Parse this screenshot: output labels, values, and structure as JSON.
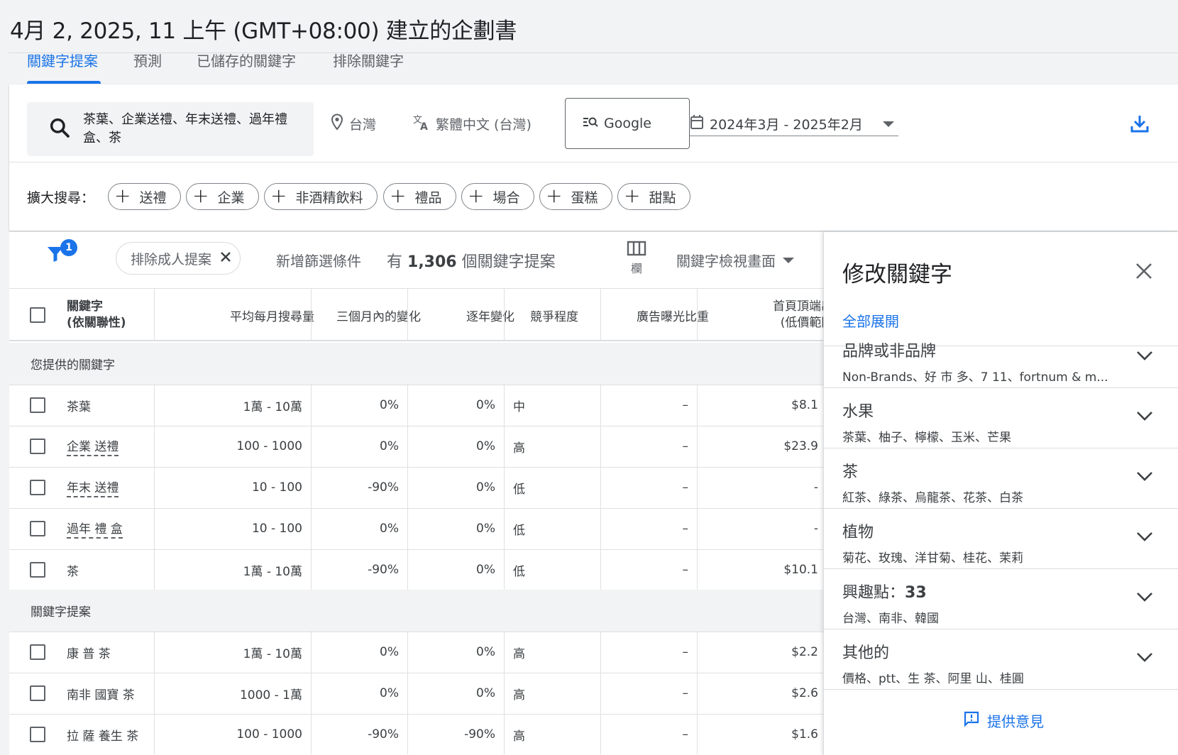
{
  "page": {
    "title": "4月 2, 2025, 11 上午 (GMT+08:00) 建立的企劃書"
  },
  "tabs": [
    {
      "label": "關鍵字提案",
      "active": true
    },
    {
      "label": "預測"
    },
    {
      "label": "已儲存的關鍵字"
    },
    {
      "label": "排除關鍵字"
    }
  ],
  "search": {
    "value": "茶葉、企業送禮、年末送禮、過年禮盒、茶",
    "icon": "search-icon"
  },
  "location": {
    "label": "台灣",
    "icon": "location-pin-icon"
  },
  "language": {
    "label": "繁體中文 (台灣)",
    "icon": "translate-icon"
  },
  "network": {
    "label": "Google",
    "icon": "search-network-icon"
  },
  "date_range": {
    "label": "2024年3月 - 2025年2月",
    "icon": "calendar-icon"
  },
  "download": {
    "icon": "download-icon"
  },
  "expand_search": {
    "label": "擴大搜尋：",
    "chips": [
      "送禮",
      "企業",
      "非酒精飲料",
      "禮品",
      "場合",
      "蛋糕",
      "甜點"
    ]
  },
  "filter_bar": {
    "filter_badge": "1",
    "chip_label": "排除成人提案",
    "add_filter": "新增篩選條件",
    "count_prefix": "有",
    "count": "1,306",
    "count_suffix": "個關鍵字提案",
    "columns_label": "欄",
    "view_label": "關鍵字檢視畫面"
  },
  "table": {
    "headers": {
      "keyword_1": "關鍵字",
      "keyword_2": "(依關聯性)",
      "avg_searches": "平均每月搜尋量",
      "three_month": "三個月內的變化",
      "yoy": "逐年變化",
      "competition": "競爭程度",
      "impression_share": "廣告曝光比重",
      "top_bid_1": "首頁頂端出價",
      "top_bid_2": "(低價範圍)"
    },
    "group1": "您提供的關鍵字",
    "rows1": [
      {
        "kw": "茶葉",
        "avg": "1萬 - 10萬",
        "m3": "0%",
        "yoy": "0%",
        "comp": "中",
        "share": "–",
        "bid": "$8.1",
        "dotted": false
      },
      {
        "kw": "企業 送禮",
        "avg": "100 - 1000",
        "m3": "0%",
        "yoy": "0%",
        "comp": "高",
        "share": "–",
        "bid": "$23.9",
        "dotted": true
      },
      {
        "kw": "年末 送禮",
        "avg": "10 - 100",
        "m3": "-90%",
        "yoy": "0%",
        "comp": "低",
        "share": "–",
        "bid": "-",
        "dotted": true
      },
      {
        "kw": "過年 禮 盒",
        "avg": "10 - 100",
        "m3": "0%",
        "yoy": "0%",
        "comp": "低",
        "share": "–",
        "bid": "-",
        "dotted": true
      },
      {
        "kw": "茶",
        "avg": "1萬 - 10萬",
        "m3": "-90%",
        "yoy": "0%",
        "comp": "低",
        "share": "–",
        "bid": "$10.1",
        "dotted": false
      }
    ],
    "group2": "關鍵字提案",
    "rows2": [
      {
        "kw": "康 普 茶",
        "avg": "1萬 - 10萬",
        "m3": "0%",
        "yoy": "0%",
        "comp": "高",
        "share": "–",
        "bid": "$2.2",
        "dotted": false
      },
      {
        "kw": "南非 國寶 茶",
        "avg": "1000 - 1萬",
        "m3": "0%",
        "yoy": "0%",
        "comp": "高",
        "share": "–",
        "bid": "$2.6",
        "dotted": false
      },
      {
        "kw": "拉 薩 養生 茶",
        "avg": "100 - 1000",
        "m3": "-90%",
        "yoy": "-90%",
        "comp": "高",
        "share": "–",
        "bid": "$1.6",
        "dotted": false
      }
    ]
  },
  "panel": {
    "title": "修改關鍵字",
    "expand_all": "全部展開",
    "groups": [
      {
        "title": "品牌或非品牌",
        "sub": "Non-Brands、好 市 多、7 11、fortnum & m..."
      },
      {
        "title": "水果",
        "sub": "茶葉、柚子、檸檬、玉米、芒果"
      },
      {
        "title": "茶",
        "sub": "紅茶、綠茶、烏龍茶、花茶、白茶"
      },
      {
        "title": "植物",
        "sub": "菊花、玫瑰、洋甘菊、桂花、茉莉"
      },
      {
        "title": "興趣點：",
        "title_count": "33",
        "sub": "台灣、南非、韓國"
      },
      {
        "title": "其他的",
        "sub": "價格、ptt、生 茶、阿里 山、桂圓"
      }
    ],
    "feedback": "提供意見"
  },
  "colors": {
    "accent": "#1a73e8",
    "text": "#3c4043",
    "bg": "#f1f3f4"
  }
}
